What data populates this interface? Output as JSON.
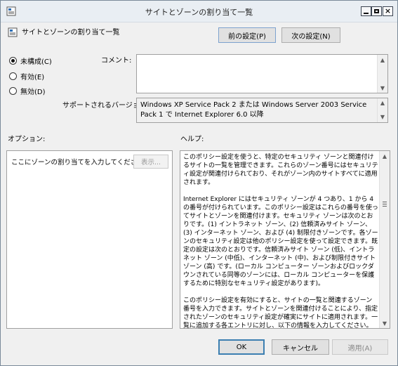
{
  "window": {
    "title": "サイトとゾーンの割り当て一覧",
    "close_glyph": "×"
  },
  "header": {
    "title": "サイトとゾーンの割り当て一覧",
    "prev_button": "前の設定(P)",
    "next_button": "次の設定(N)"
  },
  "state_options": [
    {
      "label": "未構成(C)",
      "checked": true
    },
    {
      "label": "有効(E)",
      "checked": false
    },
    {
      "label": "無効(D)",
      "checked": false
    }
  ],
  "comment": {
    "label": "コメント:",
    "value": ""
  },
  "supported": {
    "label": "サポートされるバージョン:",
    "value": "Windows XP Service Pack 2 または Windows Server 2003 Service Pack 1 で Internet Explorer 6.0 以降"
  },
  "options": {
    "label": "オプション:",
    "prompt": "ここにゾーンの割り当てを入力してください。",
    "display_button": "表示..."
  },
  "help": {
    "label": "ヘルプ:",
    "text": "このポリシー設定を使うと、特定のセキュリティ ゾーンと関連付けるサイトの一覧を管理できます。これらのゾーン番号にはセキュリティ設定が関連付けられており、それがゾーン内のサイトすべてに適用されます。\n\nInternet Explorer にはセキュリティ ゾーンが 4 つあり、1 から 4 の番号が付けられています。このポリシー設定はこれらの番号を使ってサイトとゾーンを関連付けます。セキュリティ ゾーンは次のとおりです。(1) イントラネット ゾーン、(2) 信頼済みサイト ゾーン、(3) インターネット ゾーン、および (4) 制限付きゾーンです。各ゾーンのセキュリティ設定は他のポリシー設定を使って設定できます。既定の設定は次のとおりです。信頼済みサイト ゾーン (低)、イントラネット ゾーン (中低)、インターネット (中)、および制限付きサイト ゾーン (高) です。(ローカル コンピューター ゾーンおよびロックダウンされている同等のゾーンには、ローカル コンピューターを保護するために特別なセキュリティ設定があります)。\n\nこのポリシー設定を有効にすると、サイトの一覧と関連するゾーン番号を入力できます。サイトとゾーンを関連付けることにより、指定されたゾーンのセキュリティ設定が確実にサイトに適用されます。一覧に追加する各エントリに対し、以下の情報を入力してください。"
  },
  "footer": {
    "ok": "OK",
    "cancel": "キャンセル",
    "apply": "適用(A)"
  }
}
